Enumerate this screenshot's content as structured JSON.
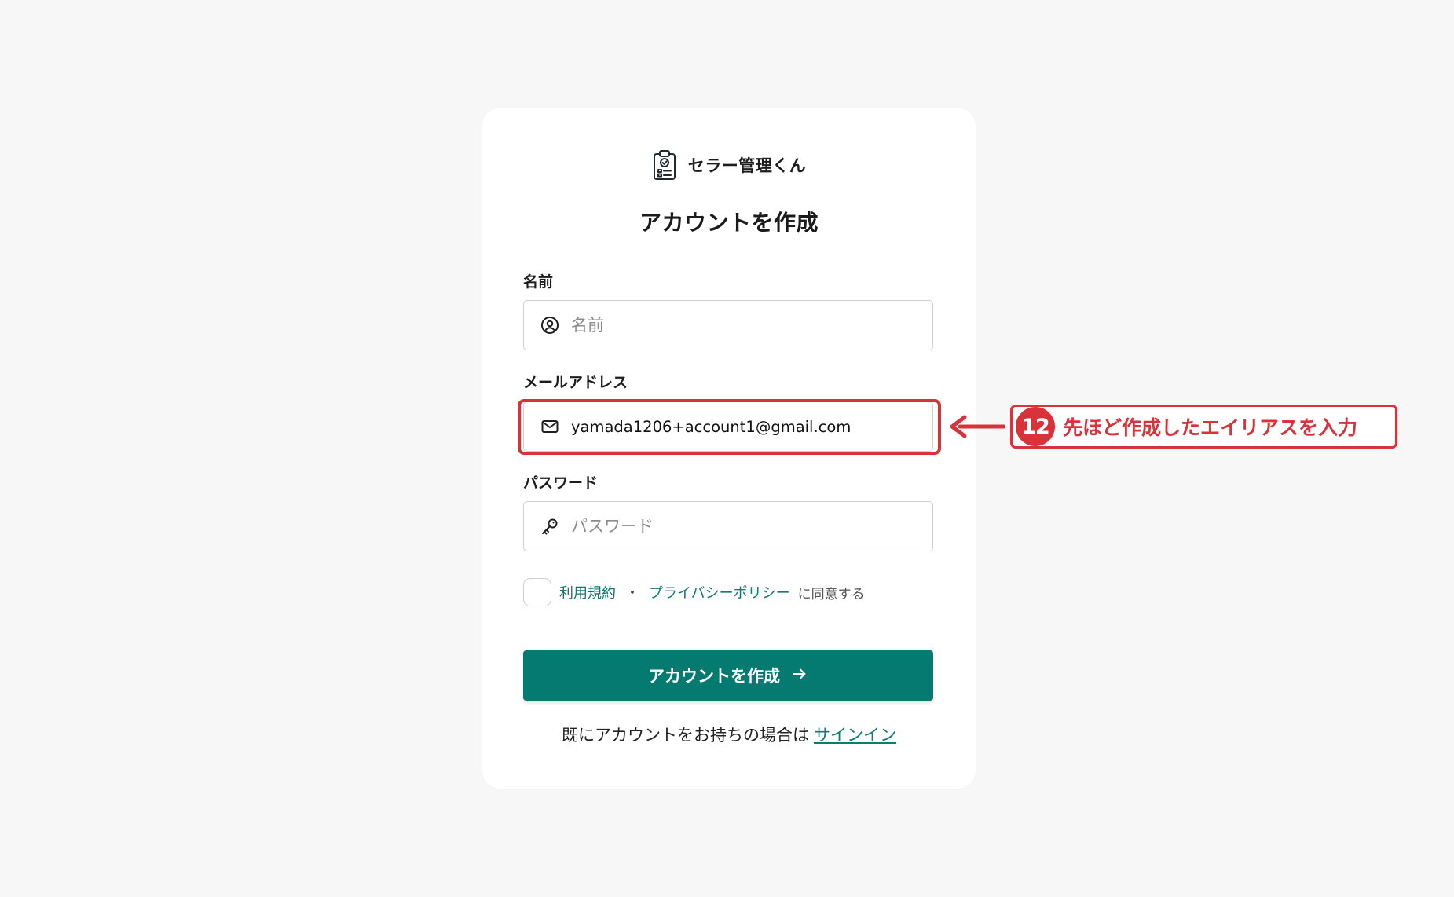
{
  "app": {
    "name": "セラー管理くん",
    "logo_icon": "clipboard-check-icon"
  },
  "page": {
    "title": "アカウントを作成"
  },
  "form": {
    "name": {
      "label": "名前",
      "placeholder": "名前",
      "value": "",
      "icon": "user-circle-icon"
    },
    "email": {
      "label": "メールアドレス",
      "placeholder": "",
      "value": "yamada1206+account1@gmail.com",
      "icon": "mail-icon"
    },
    "password": {
      "label": "パスワード",
      "placeholder": "パスワード",
      "value": "",
      "icon": "key-icon"
    },
    "terms": {
      "checked": false,
      "terms_link": "利用規約",
      "separator": "・",
      "privacy_link": "プライバシーポリシー",
      "suffix": "に同意する"
    },
    "submit": {
      "label": "アカウントを作成",
      "icon": "arrow-right-icon"
    },
    "signin": {
      "prompt": "既にアカウントをお持ちの場合は",
      "link": "サインイン"
    }
  },
  "annotation": {
    "step": "12",
    "text": "先ほど作成したエイリアスを入力",
    "color": "#d8323a"
  },
  "colors": {
    "primary": "#047a70",
    "link": "#0f7a70",
    "background": "#f7f7f7"
  }
}
